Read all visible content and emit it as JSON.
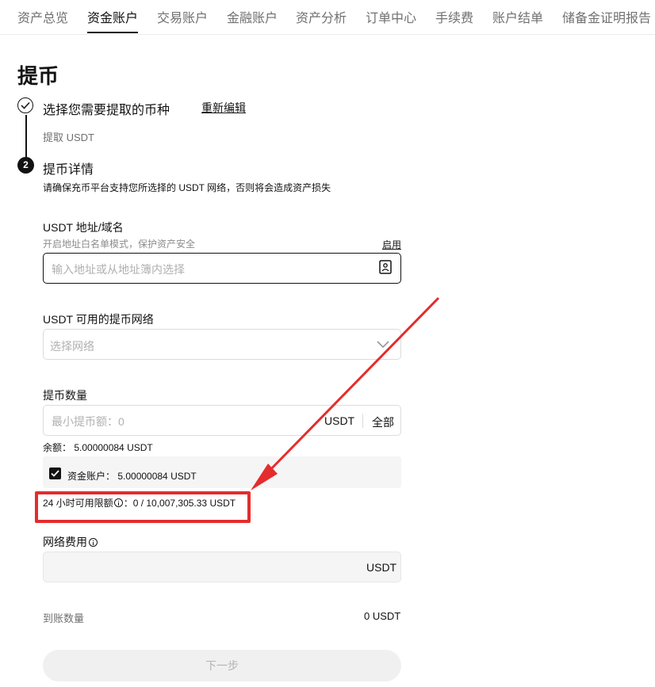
{
  "nav": {
    "tabs": [
      "资产总览",
      "资金账户",
      "交易账户",
      "金融账户",
      "资产分析",
      "订单中心",
      "手续费",
      "账户结单",
      "储备金证明报告"
    ],
    "active_index": 1
  },
  "page": {
    "title": "提币"
  },
  "steps": {
    "step1": {
      "title": "选择您需要提取的币种",
      "edit_label": "重新编辑",
      "selected": "提取 USDT"
    },
    "step2": {
      "number": "2",
      "title": "提币详情",
      "note": "请确保充币平台支持您所选择的 USDT 网络，否则将会造成资产损失"
    }
  },
  "address": {
    "label": "USDT 地址/域名",
    "hint": "开启地址白名单模式，保护资产安全",
    "enable_label": "启用",
    "placeholder": "输入地址或从地址簿内选择"
  },
  "network": {
    "label": "USDT 可用的提币网络",
    "placeholder": "选择网络"
  },
  "amount": {
    "label": "提币数量",
    "placeholder": "最小提币额：0",
    "unit": "USDT",
    "all_label": "全部",
    "balance": "余额：  5.00000084 USDT",
    "fund_account": "资金账户：  5.00000084 USDT",
    "limit_label": "24 小时可用限额",
    "limit_value": "：0 / 10,007,305.33 USDT"
  },
  "fee": {
    "label": "网络费用",
    "unit": "USDT"
  },
  "receive": {
    "label": "到账数量",
    "value": "0 USDT"
  },
  "next_button": "下一步",
  "colors": {
    "accent": "#121212",
    "annotation": "#e52c2c",
    "muted": "#707070"
  }
}
